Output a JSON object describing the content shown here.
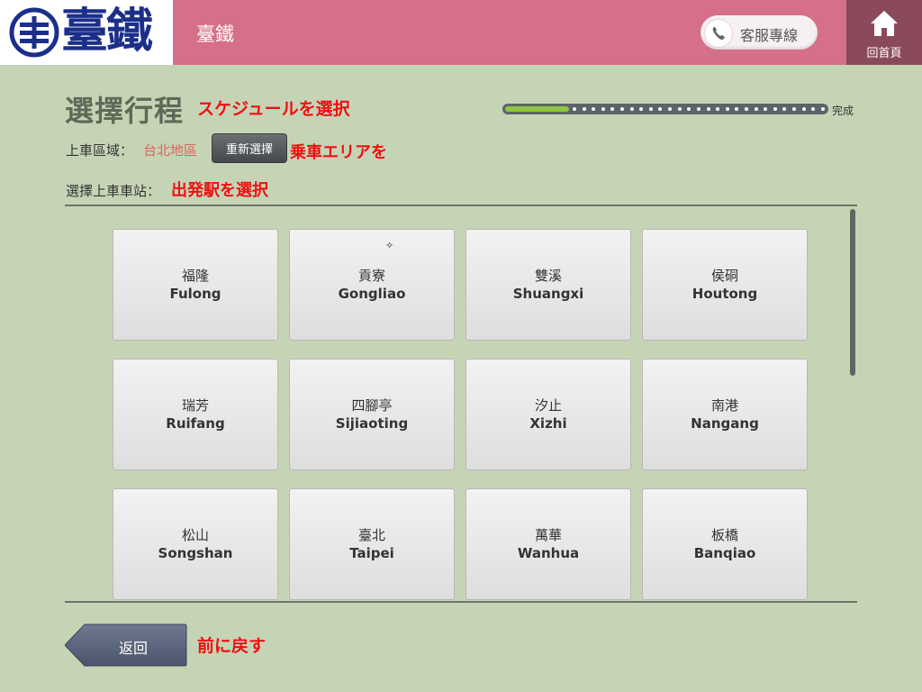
{
  "header": {
    "logo_text": "臺鐵",
    "title": "臺鐵",
    "hotline_label": "客服專線",
    "home_label": "回首頁",
    "brand_color": "#d66f88"
  },
  "page": {
    "title": "選擇行程",
    "title_note": "スケジュールを選択",
    "progress_label": "完成",
    "progress_fraction": 0.2
  },
  "area": {
    "label": "上車區域：",
    "value": "台北地區",
    "reselect_label": "重新選擇",
    "note": "乗車エリアを"
  },
  "station_select": {
    "label": "選擇上車車站：",
    "note": "出発駅を選択"
  },
  "stations": [
    {
      "zh": "福隆",
      "en": "Fulong"
    },
    {
      "zh": "貢寮",
      "en": "Gongliao"
    },
    {
      "zh": "雙溪",
      "en": "Shuangxi"
    },
    {
      "zh": "侯硐",
      "en": "Houtong"
    },
    {
      "zh": "瑞芳",
      "en": "Ruifang"
    },
    {
      "zh": "四腳亭",
      "en": "Sijiaoting"
    },
    {
      "zh": "汐止",
      "en": "Xizhi"
    },
    {
      "zh": "南港",
      "en": "Nangang"
    },
    {
      "zh": "松山",
      "en": "Songshan"
    },
    {
      "zh": "臺北",
      "en": "Taipei"
    },
    {
      "zh": "萬華",
      "en": "Wanhua"
    },
    {
      "zh": "板橋",
      "en": "Banqiao"
    }
  ],
  "footer": {
    "back_label": "返回",
    "back_note": "前に戻す"
  }
}
